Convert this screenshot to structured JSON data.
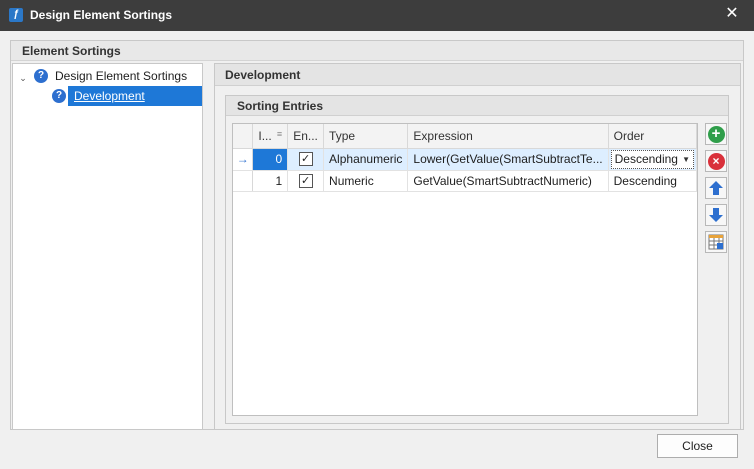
{
  "window": {
    "title": "Design Element Sortings",
    "app_icon": "app-logo-icon",
    "close_icon": "close-icon"
  },
  "outer_group": {
    "title": "Element Sortings"
  },
  "tree": {
    "root": {
      "label": "Design Element Sortings",
      "icon": "question-icon",
      "expanded": true
    },
    "child": {
      "label": "Development",
      "icon": "question-icon",
      "selected": true
    }
  },
  "panel": {
    "title": "Development",
    "group_title": "Sorting Entries"
  },
  "grid": {
    "columns": [
      "I...",
      "En...",
      "Type",
      "Expression",
      "Order"
    ],
    "rows": [
      {
        "index": "0",
        "enabled": true,
        "type": "Alphanumeric",
        "expression": "Lower(GetValue(SmartSubtractTe...",
        "order": "Descending",
        "focused": true
      },
      {
        "index": "1",
        "enabled": true,
        "type": "Numeric",
        "expression": "GetValue(SmartSubtractNumeric)",
        "order": "Descending",
        "focused": false
      }
    ],
    "focus_indicator": "→",
    "check_glyph": "✓"
  },
  "side_buttons": [
    {
      "name": "add",
      "icon": "add-icon",
      "glyph": "+",
      "color": "#2f9e4a"
    },
    {
      "name": "remove",
      "icon": "remove-icon",
      "glyph": "×",
      "color": "#d9303a"
    },
    {
      "name": "move-up",
      "icon": "arrow-up-icon",
      "color": "#2d6fcf"
    },
    {
      "name": "move-down",
      "icon": "arrow-down-icon",
      "color": "#2d6fcf"
    },
    {
      "name": "grid-options",
      "icon": "grid-edit-icon"
    }
  ],
  "footer": {
    "close_label": "Close"
  },
  "colors": {
    "titlebar": "#3d3d3d",
    "selection": "#1e78d7",
    "accent": "#2d6fcf"
  }
}
